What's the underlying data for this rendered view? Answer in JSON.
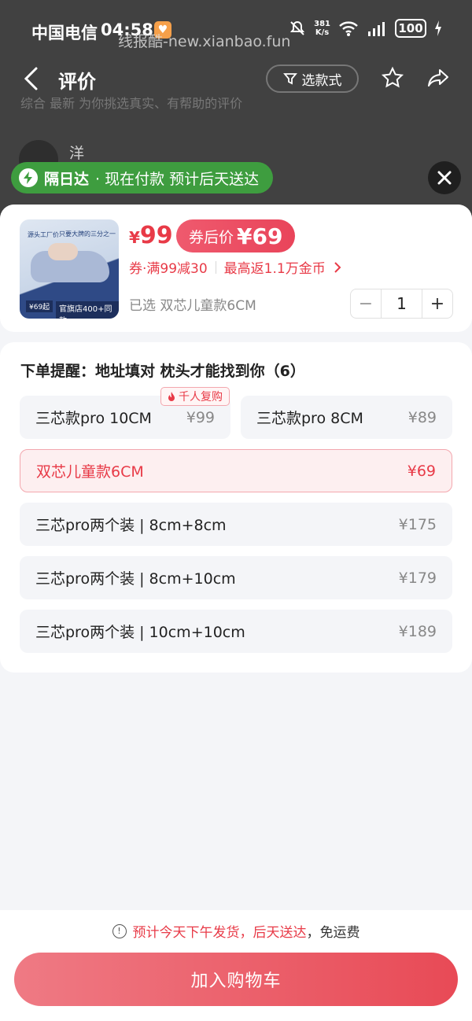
{
  "status_bar": {
    "carrier": "中国电信",
    "time": "04:58",
    "watermark": "线报酷-new.xianbao.fun",
    "speed_value": "381",
    "speed_unit": "K/s",
    "battery": "100"
  },
  "navbar": {
    "title": "评价",
    "filter_label": "选款式"
  },
  "background_review": {
    "reviewer_name": "洋**n",
    "tabs_text": "综合   最新                         为你挑选真实、有帮助的评价"
  },
  "delivery_banner": {
    "label": "隔日达",
    "text": "· 现在付款 预计后天送达"
  },
  "product": {
    "price_symbol": "¥",
    "price": "99",
    "coupon_label": "券后价",
    "coupon_symbol": "¥",
    "coupon_price": "69",
    "coupon_rule": "券·满99减30",
    "cashback": "最高返1.1万金币",
    "selected_text": "已选 双芯儿童款6CM",
    "quantity": "1",
    "thumb_tag": "源头工厂价",
    "thumb_tag2": "只要大牌的三分之一",
    "thumb_price": "¥69起",
    "thumb_store": "官旗店400+同款"
  },
  "options": {
    "title": "下单提醒：地址填对 枕头才能找到你（6）",
    "hot_badge": "千人复购",
    "items": [
      {
        "name": "三芯款pro 10CM",
        "price": "¥99"
      },
      {
        "name": "三芯款pro 8CM",
        "price": "¥89"
      },
      {
        "name": "双芯儿童款6CM",
        "price": "¥69"
      },
      {
        "name": "三芯pro两个装 | 8cm+8cm",
        "price": "¥175"
      },
      {
        "name": "三芯pro两个装 | 8cm+10cm",
        "price": "¥179"
      },
      {
        "name": "三芯pro两个装 | 10cm+10cm",
        "price": "¥189"
      }
    ]
  },
  "bottom": {
    "ship_highlight": "预计今天下午发货，后天送达",
    "ship_plain": "，免运费",
    "cart_button": "加入购物车"
  },
  "colors": {
    "accent": "#e83a47",
    "green": "#3e9d3f",
    "selected_bg": "#fdeff0"
  }
}
